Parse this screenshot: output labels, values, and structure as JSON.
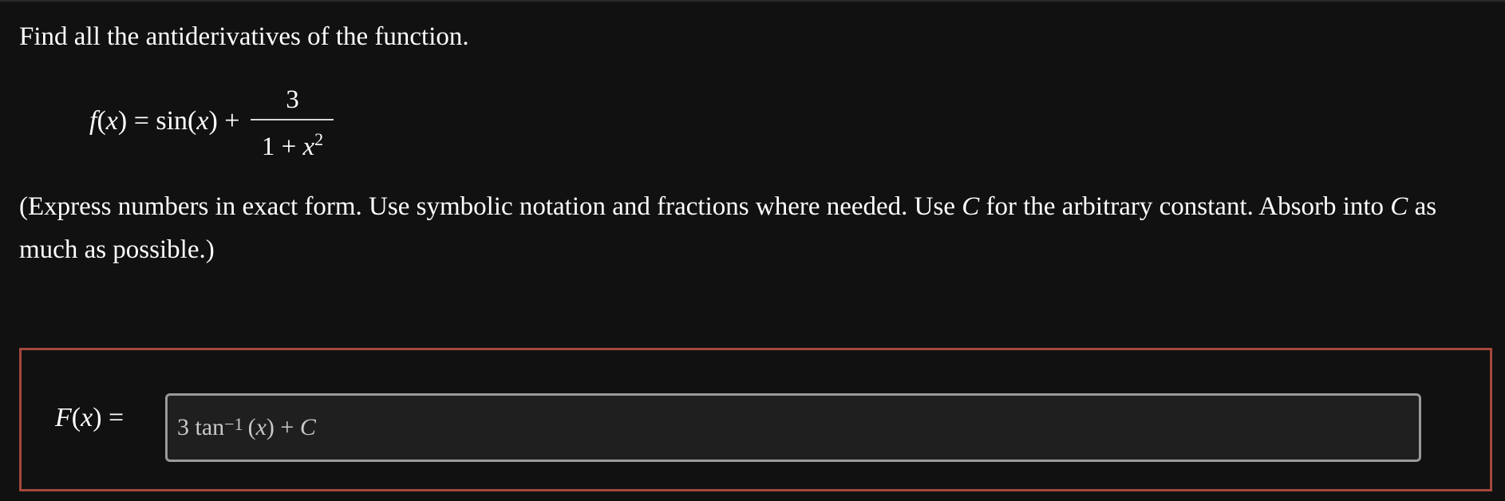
{
  "question": {
    "text": "Find all the antiderivatives of the function."
  },
  "equation": {
    "lhs_func": "f",
    "lhs_var_open": "(",
    "lhs_var": "x",
    "lhs_rest": ") = sin(",
    "lhs_var2": "x",
    "lhs_end": ") +",
    "numerator": "3",
    "denominator_base": "1 + ",
    "denominator_var": "x",
    "denominator_exp": "2"
  },
  "instructions": {
    "part1": "(Express numbers in exact form. Use symbolic notation and fractions where needed. Use ",
    "c1": "C",
    "part2": " for the arbitrary constant. Absorb into ",
    "c2": "C",
    "part3": " as much as possible.)"
  },
  "answer": {
    "label_func": "F",
    "label_open": "(",
    "label_var": "x",
    "label_close": ") =",
    "value_coef": "3 tan",
    "value_exp": "−1",
    "value_open": "(",
    "value_var": "x",
    "value_close": ") + ",
    "value_const": "C"
  },
  "colors": {
    "background": "#111111",
    "answer_border": "#a5473d",
    "input_border": "#9a9a9a",
    "input_background": "#1f1f1f"
  }
}
